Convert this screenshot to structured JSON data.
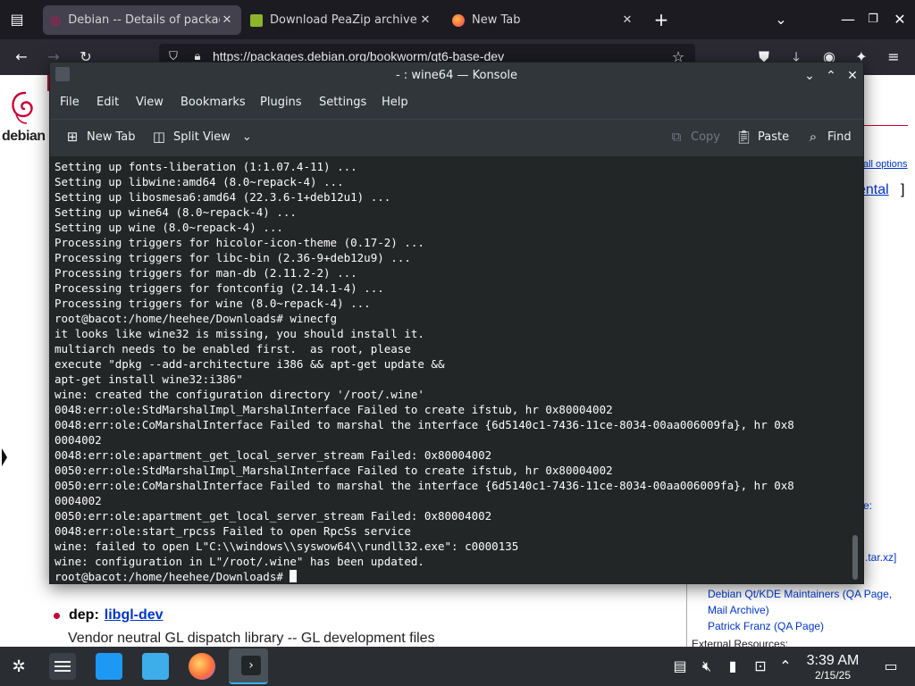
{
  "browser": {
    "tabs": [
      {
        "title": "Debian -- Details of package",
        "active": true
      },
      {
        "title": "Download PeaZip archive",
        "active": false
      },
      {
        "title": "New Tab",
        "active": false
      }
    ],
    "url": "https://packages.debian.org/bookworm/qt6-base-dev"
  },
  "webpage": {
    "logo_text": "debian",
    "right_links": {
      "all_options": "all options",
      "experimental": "ental",
      "bracket": "]",
      "frag_e": "e:",
      "tarxz": ".tar.xz]"
    },
    "maintainers": [
      "Debian Qt/KDE Maintainers (QA Page,",
      "Mail Archive)",
      "Patrick Franz (QA Page)"
    ],
    "external_resources": "External Resources:",
    "dep_label": "dep:",
    "dep_package": "libgl-dev",
    "dep_description": "Vendor neutral GL dispatch library -- GL development files"
  },
  "konsole": {
    "title": "- : wine64 — Konsole",
    "menu": [
      "File",
      "Edit",
      "View",
      "Bookmarks",
      "Plugins",
      "Settings",
      "Help"
    ],
    "toolbar": {
      "new_tab": "New Tab",
      "split_view": "Split View",
      "copy": "Copy",
      "paste": "Paste",
      "find": "Find"
    },
    "lines": [
      "Setting up fonts-liberation (1:1.07.4-11) ...",
      "Setting up libwine:amd64 (8.0~repack-4) ...",
      "Setting up libosmesa6:amd64 (22.3.6-1+deb12u1) ...",
      "Setting up wine64 (8.0~repack-4) ...",
      "Setting up wine (8.0~repack-4) ...",
      "Processing triggers for hicolor-icon-theme (0.17-2) ...",
      "Processing triggers for libc-bin (2.36-9+deb12u9) ...",
      "Processing triggers for man-db (2.11.2-2) ...",
      "Processing triggers for fontconfig (2.14.1-4) ...",
      "Processing triggers for wine (8.0~repack-4) ...",
      "root@bacot:/home/heehee/Downloads# winecfg",
      "it looks like wine32 is missing, you should install it.",
      "multiarch needs to be enabled first.  as root, please",
      "execute \"dpkg --add-architecture i386 && apt-get update &&",
      "apt-get install wine32:i386\"",
      "wine: created the configuration directory '/root/.wine'",
      "0048:err:ole:StdMarshalImpl_MarshalInterface Failed to create ifstub, hr 0x80004002",
      "0048:err:ole:CoMarshalInterface Failed to marshal the interface {6d5140c1-7436-11ce-8034-00aa006009fa}, hr 0x8",
      "0004002",
      "0048:err:ole:apartment_get_local_server_stream Failed: 0x80004002",
      "0050:err:ole:StdMarshalImpl_MarshalInterface Failed to create ifstub, hr 0x80004002",
      "0050:err:ole:CoMarshalInterface Failed to marshal the interface {6d5140c1-7436-11ce-8034-00aa006009fa}, hr 0x8",
      "0004002",
      "0050:err:ole:apartment_get_local_server_stream Failed: 0x80004002",
      "0048:err:ole:start_rpcss Failed to open RpcSs service",
      "wine: failed to open L\"C:\\\\windows\\\\syswow64\\\\rundll32.exe\": c0000135",
      "wine: configuration in L\"/root/.wine\" has been updated."
    ],
    "prompt": "root@bacot:/home/heehee/Downloads# "
  },
  "taskbar": {
    "time": "3:39 AM",
    "date": "2/15/25"
  },
  "colors": {
    "terminal_bg": "#232627",
    "konsole_chrome": "#31363b",
    "debian_red": "#c70036",
    "link_blue": "#0035c7",
    "taskbar_bg": "#2a2e32"
  }
}
